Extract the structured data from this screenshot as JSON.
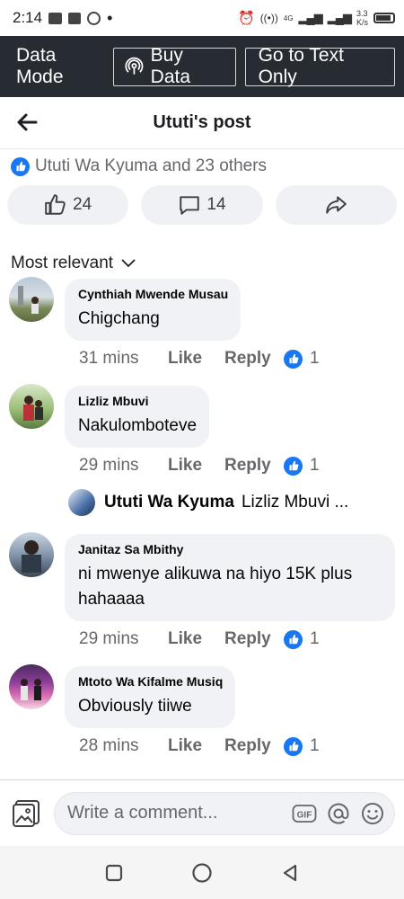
{
  "status": {
    "time": "2:14",
    "net_speed_top": "3.3",
    "net_speed_bottom": "K/s",
    "net_type": "4G"
  },
  "data_mode": {
    "label": "Data Mode",
    "buy_data": "Buy Data",
    "text_only": "Go to Text Only"
  },
  "header": {
    "title": "Ututi's post"
  },
  "reactions": {
    "summary": "Ututi Wa Kyuma and 23 others"
  },
  "actions": {
    "like_count": "24",
    "comment_count": "14"
  },
  "sort": {
    "label": "Most relevant"
  },
  "comments": [
    {
      "name": "Cynthiah Mwende Musau",
      "text": "Chigchang",
      "time": "31 mins",
      "like": "Like",
      "reply": "Reply",
      "reactions": "1"
    },
    {
      "name": "Lizliz Mbuvi",
      "text": "Nakulomboteve",
      "time": "29 mins",
      "like": "Like",
      "reply": "Reply",
      "reactions": "1"
    },
    {
      "name": "Janitaz Sa Mbithy",
      "text": "ni mwenye alikuwa na hiyo 15K plus hahaaaa",
      "time": "29 mins",
      "like": "Like",
      "reply": "Reply",
      "reactions": "1"
    },
    {
      "name": "Mtoto Wa Kifalme Musiq",
      "text": "Obviously tiiwe",
      "time": "28 mins",
      "like": "Like",
      "reply": "Reply",
      "reactions": "1"
    }
  ],
  "reply_preview": {
    "author": "Ututi Wa Kyuma",
    "snippet": "Lizliz Mbuvi ..."
  },
  "composer": {
    "placeholder": "Write a comment...",
    "gif_label": "GIF"
  },
  "colors": {
    "accent": "#1877f2",
    "data_mode_bg": "#272c33",
    "bubble_bg": "#f0f2f5"
  }
}
